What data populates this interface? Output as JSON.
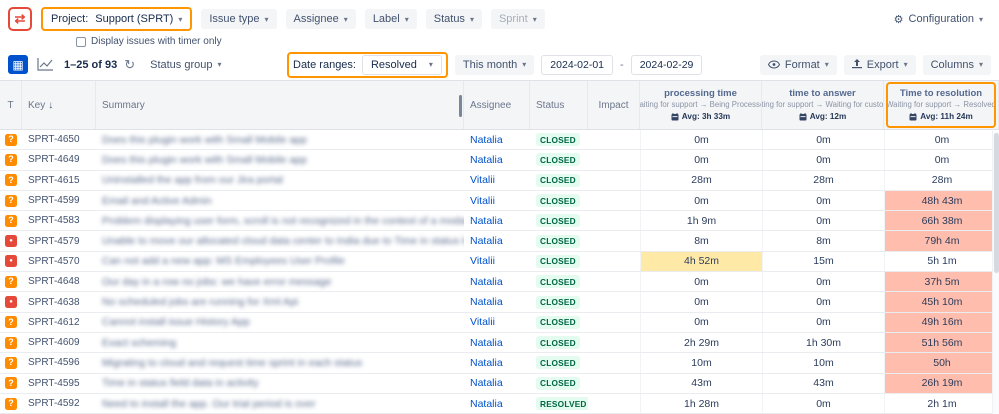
{
  "filters": {
    "project_label": "Project:",
    "project_value": "Support (SPRT)",
    "issue_type": "Issue type",
    "assignee": "Assignee",
    "label": "Label",
    "status": "Status",
    "sprint": "Sprint",
    "configuration": "Configuration",
    "timer_only_label": "Display issues with timer only"
  },
  "toolbar": {
    "pagination": "1–25 of 93",
    "status_group": "Status group",
    "date_ranges_label": "Date ranges:",
    "date_ranges_value": "Resolved",
    "period": "This month",
    "date_from": "2024-02-01",
    "date_to": "2024-02-29",
    "format": "Format",
    "export": "Export",
    "columns": "Columns"
  },
  "table": {
    "headers": {
      "type": "T",
      "key": "Key",
      "summary": "Summary",
      "assignee": "Assignee",
      "status": "Status",
      "impact": "Impact"
    },
    "time_columns": {
      "processing": {
        "title": "processing time",
        "subtitle": "Waiting for support → Being Processed",
        "avg": "Avg: 3h 33m"
      },
      "answer": {
        "title": "time to answer",
        "subtitle": "Waiting for support → Waiting for customer",
        "avg": "Avg: 12m"
      },
      "resolution": {
        "title": "Time to resolution",
        "subtitle": "Waiting for support → Resolved",
        "avg": "Avg: 11h 24m"
      }
    },
    "rows": [
      {
        "type": "question",
        "key": "SPRT-4650",
        "summary": "Does this plugin work with Small Mobile app",
        "assignee": "Natalia",
        "status": "CLOSED",
        "processing": "0m",
        "answer": "0m",
        "resolution": "0m",
        "processing_hl": "",
        "resolution_hl": ""
      },
      {
        "type": "question",
        "key": "SPRT-4649",
        "summary": "Does this plugin work with Small Mobile app",
        "assignee": "Natalia",
        "status": "CLOSED",
        "processing": "0m",
        "answer": "0m",
        "resolution": "0m",
        "processing_hl": "",
        "resolution_hl": ""
      },
      {
        "type": "question",
        "key": "SPRT-4615",
        "summary": "Uninstalled the app from our Jira portal",
        "assignee": "Vitalii",
        "status": "CLOSED",
        "processing": "28m",
        "answer": "28m",
        "resolution": "28m",
        "processing_hl": "",
        "resolution_hl": ""
      },
      {
        "type": "question",
        "key": "SPRT-4599",
        "summary": "Email and Active Admin",
        "assignee": "Vitalii",
        "status": "CLOSED",
        "processing": "0m",
        "answer": "0m",
        "resolution": "48h 43m",
        "processing_hl": "",
        "resolution_hl": "red"
      },
      {
        "type": "question",
        "key": "SPRT-4583",
        "summary": "Problem displaying user form, scroll is not recognized in the context of a modal",
        "assignee": "Natalia",
        "status": "CLOSED",
        "processing": "1h 9m",
        "answer": "0m",
        "resolution": "66h 38m",
        "processing_hl": "",
        "resolution_hl": "red"
      },
      {
        "type": "bug",
        "key": "SPRT-4579",
        "summary": "Unable to move our allocated cloud data center to India due to Time in status length",
        "assignee": "Natalia",
        "status": "CLOSED",
        "processing": "8m",
        "answer": "8m",
        "resolution": "79h 4m",
        "processing_hl": "",
        "resolution_hl": "red"
      },
      {
        "type": "bug",
        "key": "SPRT-4570",
        "summary": "Can not add a new app: MS Employees User Profile",
        "assignee": "Vitalii",
        "status": "CLOSED",
        "processing": "4h 52m",
        "answer": "15m",
        "resolution": "5h 1m",
        "processing_hl": "yellow",
        "resolution_hl": ""
      },
      {
        "type": "question",
        "key": "SPRT-4648",
        "summary": "Our day in a row no jobs: we have error message",
        "assignee": "Natalia",
        "status": "CLOSED",
        "processing": "0m",
        "answer": "0m",
        "resolution": "37h 5m",
        "processing_hl": "",
        "resolution_hl": "red"
      },
      {
        "type": "bug",
        "key": "SPRT-4638",
        "summary": "No scheduled jobs are running for Xml Api",
        "assignee": "Natalia",
        "status": "CLOSED",
        "processing": "0m",
        "answer": "0m",
        "resolution": "45h 10m",
        "processing_hl": "",
        "resolution_hl": "red"
      },
      {
        "type": "question",
        "key": "SPRT-4612",
        "summary": "Cannot install issue History App",
        "assignee": "Vitalii",
        "status": "CLOSED",
        "processing": "0m",
        "answer": "0m",
        "resolution": "49h 16m",
        "processing_hl": "",
        "resolution_hl": "red"
      },
      {
        "type": "question",
        "key": "SPRT-4609",
        "summary": "Exact scheming",
        "assignee": "Natalia",
        "status": "CLOSED",
        "processing": "2h 29m",
        "answer": "1h 30m",
        "resolution": "51h 56m",
        "processing_hl": "",
        "resolution_hl": "red"
      },
      {
        "type": "question",
        "key": "SPRT-4596",
        "summary": "Migrating to cloud and request time sprint in each status",
        "assignee": "Natalia",
        "status": "CLOSED",
        "processing": "10m",
        "answer": "10m",
        "resolution": "50h",
        "processing_hl": "",
        "resolution_hl": "red"
      },
      {
        "type": "question",
        "key": "SPRT-4595",
        "summary": "Time in status field data in activity",
        "assignee": "Natalia",
        "status": "CLOSED",
        "processing": "43m",
        "answer": "43m",
        "resolution": "26h 19m",
        "processing_hl": "",
        "resolution_hl": "red"
      },
      {
        "type": "question",
        "key": "SPRT-4592",
        "summary": "Need to install the app. Our trial period is over",
        "assignee": "Natalia",
        "status": "RESOLVED",
        "processing": "1h 28m",
        "answer": "0m",
        "resolution": "2h 1m",
        "processing_hl": "",
        "resolution_hl": ""
      }
    ]
  },
  "colors": {
    "annotation": "#ff9500",
    "overdue_bg": "#ffbdad",
    "warning_bg": "#ffe9a6",
    "link": "#0052cc",
    "status_bg": "#e3fcef",
    "status_text": "#006644",
    "accent": "#0052cc"
  }
}
